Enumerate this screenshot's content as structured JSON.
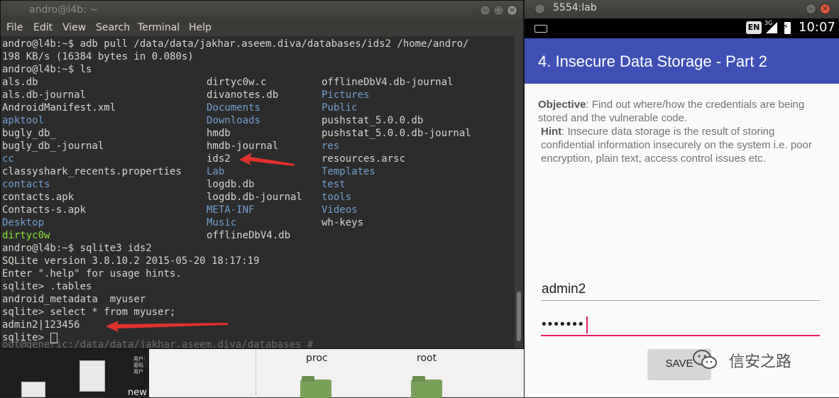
{
  "terminal": {
    "title": "andro@l4b: ~",
    "menu": [
      "File",
      "Edit",
      "View",
      "Search",
      "Terminal",
      "Help"
    ],
    "lines": [
      "andro@l4b:~$ adb pull /data/data/jakhar.aseem.diva/databases/ids2 /home/andro/",
      "198 KB/s (16384 bytes in 0.080s)",
      "andro@l4b:~$ ls"
    ],
    "ls_columns": [
      [
        {
          "name": "als.db",
          "kind": "file"
        },
        {
          "name": "als.db-journal",
          "kind": "file"
        },
        {
          "name": "AndroidManifest.xml",
          "kind": "file"
        },
        {
          "name": "apktool",
          "kind": "dir"
        },
        {
          "name": "bugly_db_",
          "kind": "file"
        },
        {
          "name": "bugly_db_-journal",
          "kind": "file"
        },
        {
          "name": "cc",
          "kind": "dir"
        },
        {
          "name": "classyshark_recents.properties",
          "kind": "file"
        },
        {
          "name": "contacts",
          "kind": "dir"
        },
        {
          "name": "contacts.apk",
          "kind": "file"
        },
        {
          "name": "Contacts-s.apk",
          "kind": "file"
        },
        {
          "name": "Desktop",
          "kind": "dir"
        },
        {
          "name": "dirtyc0w",
          "kind": "exe"
        }
      ],
      [
        {
          "name": "dirtyc0w.c",
          "kind": "file"
        },
        {
          "name": "divanotes.db",
          "kind": "file"
        },
        {
          "name": "Documents",
          "kind": "dir"
        },
        {
          "name": "Downloads",
          "kind": "dir"
        },
        {
          "name": "hmdb",
          "kind": "file"
        },
        {
          "name": "hmdb-journal",
          "kind": "file"
        },
        {
          "name": "ids2",
          "kind": "file"
        },
        {
          "name": "Lab",
          "kind": "dir"
        },
        {
          "name": "logdb.db",
          "kind": "file"
        },
        {
          "name": "logdb.db-journal",
          "kind": "file"
        },
        {
          "name": "META-INF",
          "kind": "dir"
        },
        {
          "name": "Music",
          "kind": "dir"
        },
        {
          "name": "offlineDbV4.db",
          "kind": "file"
        }
      ],
      [
        {
          "name": "offlineDbV4.db-journal",
          "kind": "file"
        },
        {
          "name": "Pictures",
          "kind": "dir"
        },
        {
          "name": "Public",
          "kind": "dir"
        },
        {
          "name": "pushstat_5.0.0.db",
          "kind": "file"
        },
        {
          "name": "pushstat_5.0.0.db-journal",
          "kind": "file"
        },
        {
          "name": "res",
          "kind": "dir"
        },
        {
          "name": "resources.arsc",
          "kind": "file"
        },
        {
          "name": "Templates",
          "kind": "dir"
        },
        {
          "name": "test",
          "kind": "dir"
        },
        {
          "name": "tools",
          "kind": "dir"
        },
        {
          "name": "Videos",
          "kind": "dir"
        },
        {
          "name": "wh-keys",
          "kind": "file"
        }
      ]
    ],
    "after_lines": [
      "andro@l4b:~$ sqlite3 ids2",
      "SQLite version 3.8.10.2 2015-05-20 18:17:19",
      "Enter \".help\" for usage hints.",
      "sqlite> .tables",
      "android_metadata  myuser",
      "sqlite> select * from myuser;",
      "admin2|123456",
      "sqlite> "
    ],
    "ghost_line": "oot@generic:/data/data/jakhar.aseem.diva/databases #"
  },
  "desktop": {
    "folder_labels": [
      "proc",
      "root"
    ],
    "file_label": "new",
    "note_lines": [
      "用户:",
      "密码",
      "用户"
    ]
  },
  "emulator": {
    "window_title": "5554:lab",
    "status": {
      "lang": "EN",
      "network": "3G",
      "time": "10:07"
    },
    "app_title": "4. Insecure Data Storage - Part 2",
    "objective_label": "Objective",
    "objective_text": ": Find out where/how the credentials are being stored and the vulnerable code.",
    "hint_label": "Hint",
    "hint_text": ": Insecure data storage is the result of storing confidential information insecurely on the system i.e. poor encryption, plain text, access control issues etc.",
    "username_value": "admin2",
    "password_value": "•••••••",
    "save_label": "SAVE"
  },
  "watermark": {
    "text": "信安之路"
  },
  "colors": {
    "terminal_bg": "#2c2c2c",
    "dir": "#729fcf",
    "exe": "#8ae234",
    "appbar": "#3f51b5",
    "accent": "#e91e63",
    "arrow": "#e0322a"
  }
}
